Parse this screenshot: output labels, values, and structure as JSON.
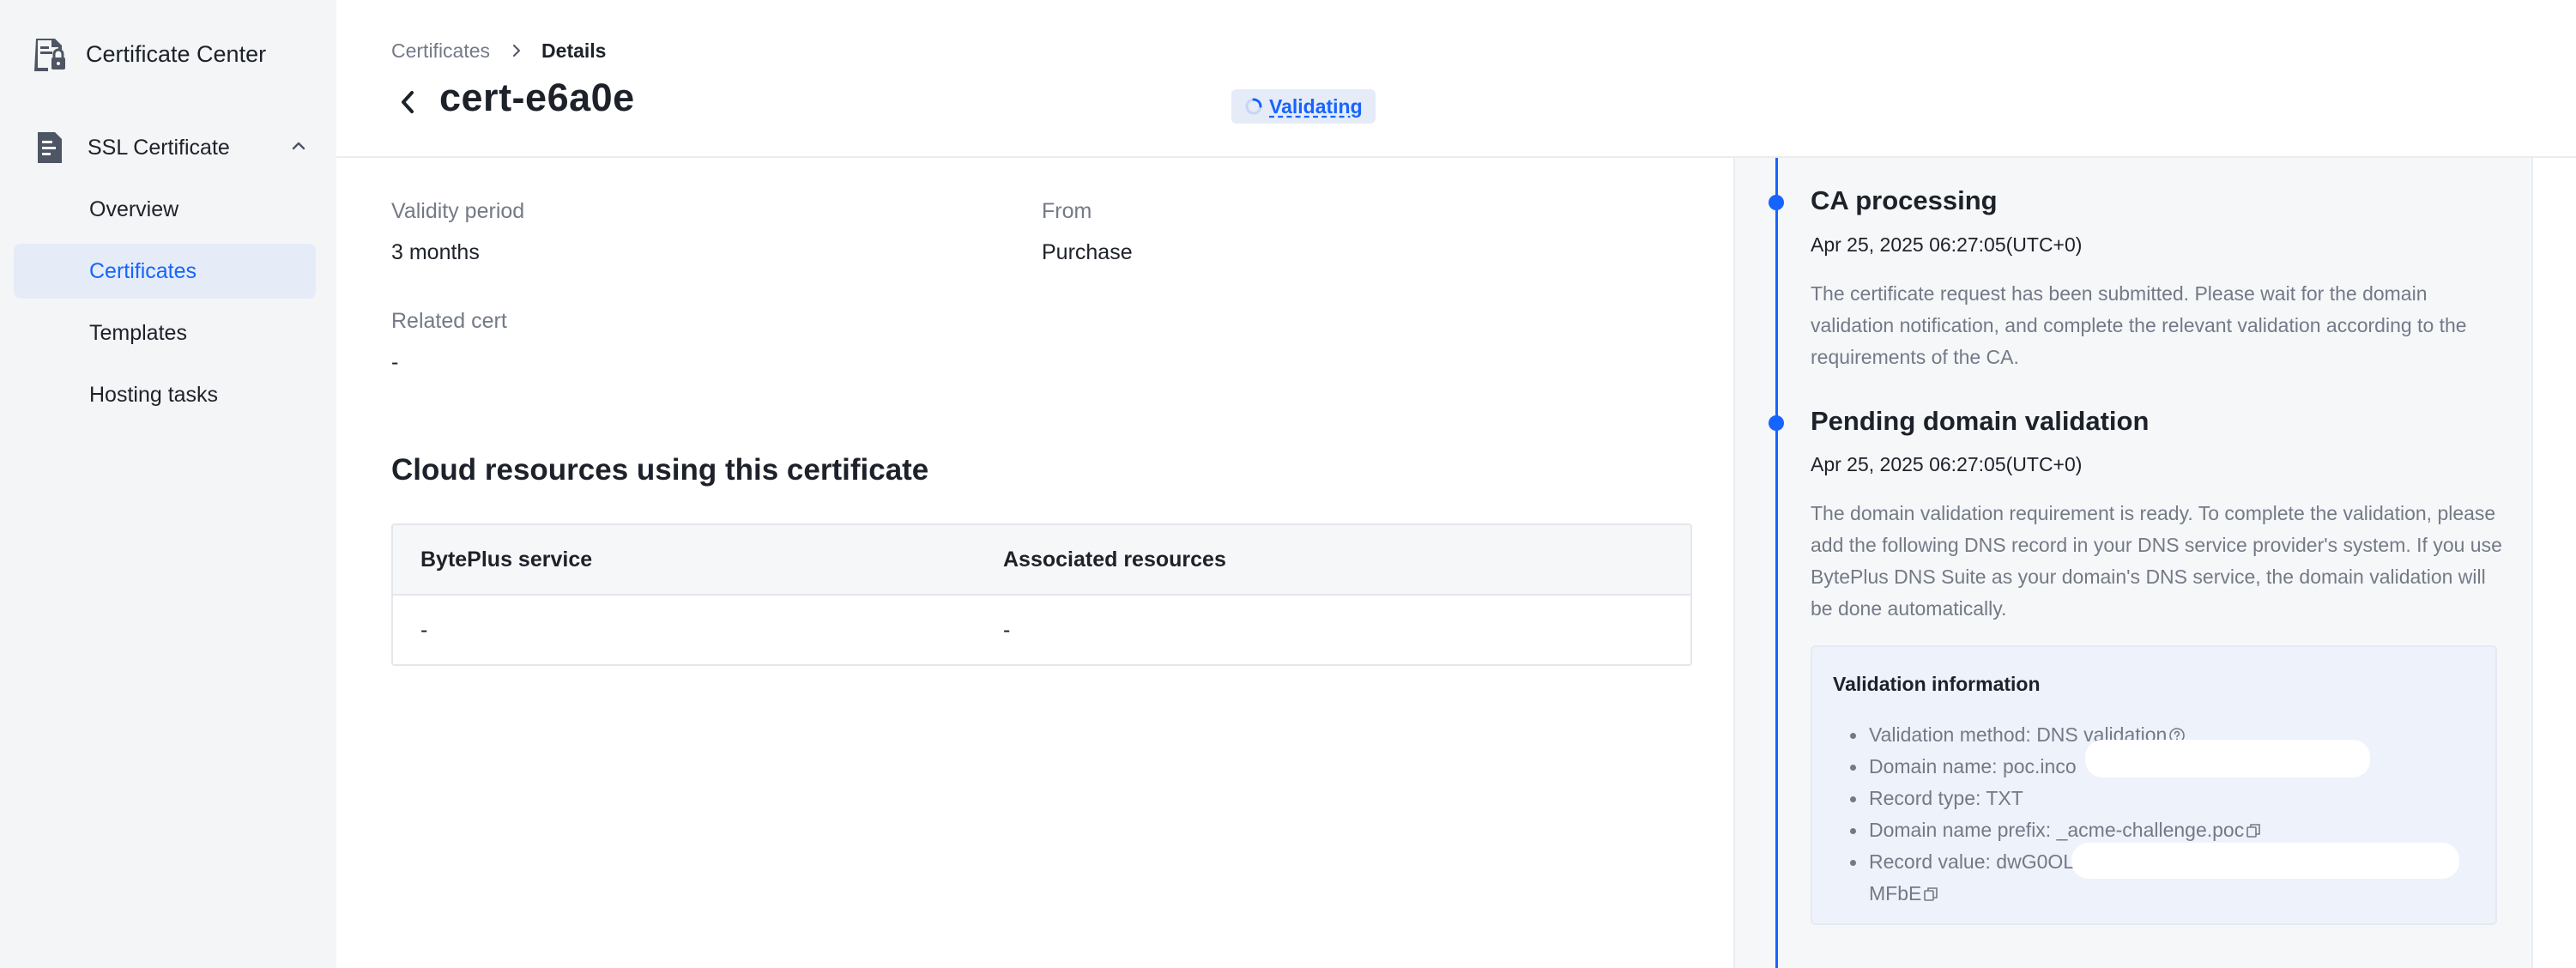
{
  "sidebar": {
    "brand": "Certificate Center",
    "group": "SSL Certificate",
    "items": [
      {
        "label": "Overview"
      },
      {
        "label": "Certificates"
      },
      {
        "label": "Templates"
      },
      {
        "label": "Hosting tasks"
      }
    ],
    "active_item": "Certificates"
  },
  "header": {
    "breadcrumb": [
      "Certificates",
      "Details"
    ],
    "title": "cert-e6a0e",
    "status": "Validating"
  },
  "details": {
    "validity_label": "Validity period",
    "validity_value": "3 months",
    "from_label": "From",
    "from_value": "Purchase",
    "related_label": "Related cert",
    "related_value": "-"
  },
  "resources": {
    "title": "Cloud resources using this certificate",
    "columns": [
      "BytePlus service",
      "Associated resources"
    ],
    "rows": [
      [
        "-",
        "-"
      ]
    ]
  },
  "timeline": [
    {
      "title": "CA processing",
      "time": "Apr 25, 2025 06:27:05(UTC+0)",
      "desc": "The certificate request has been submitted. Please wait for the domain validation notification, and complete the relevant validation according to the requirements of the CA."
    },
    {
      "title": "Pending domain validation",
      "time": "Apr 25, 2025 06:27:05(UTC+0)",
      "desc": "The domain validation requirement is ready. To complete the validation, please add the following DNS record in your DNS service provider's system. If you use BytePlus DNS Suite as your domain's DNS service, the domain validation will be done automatically."
    }
  ],
  "validation": {
    "title": "Validation information",
    "method": "Validation method: DNS validation",
    "domain": "Domain name: poc.inco",
    "record_type": "Record type: TXT",
    "prefix": "Domain name prefix: _acme-challenge.poc",
    "record_value_1": "Record value: dwG0OL",
    "record_value_2": "MFbE"
  },
  "colors": {
    "accent": "#1664ff",
    "sidebar_bg": "#f4f5f7",
    "active_bg": "#e5ecf8",
    "muted_text": "#737a87"
  }
}
